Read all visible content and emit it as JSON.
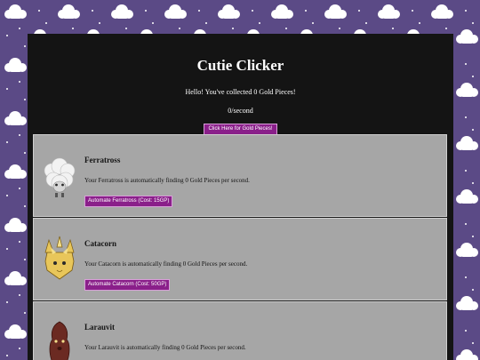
{
  "game": {
    "title": "Cutie Clicker",
    "greeting": "Hello! You've collected 0 Gold Pieces!",
    "rate": "0/second",
    "click_button": "Click Here for Gold Pieces!"
  },
  "colors": {
    "background": "#5b4a86",
    "panel": "#141414",
    "card": "#a6a6a6",
    "button": "#8a1f8a"
  },
  "cuties": [
    {
      "name": "Ferratross",
      "description": "Your Ferratross is automatically finding 0 Gold Pieces per second.",
      "button": "Automate Ferratross (Cost: 15GP)",
      "icon": "ferratross-icon"
    },
    {
      "name": "Catacorn",
      "description": "Your Catacorn is automatically finding 0 Gold Pieces per second.",
      "button": "Automate Catacorn (Cost: 50GP)",
      "icon": "catacorn-icon"
    },
    {
      "name": "Larauvit",
      "description": "Your Larauvit is automatically finding 0 Gold Pieces per second.",
      "button": "",
      "icon": "larauvit-icon"
    }
  ]
}
